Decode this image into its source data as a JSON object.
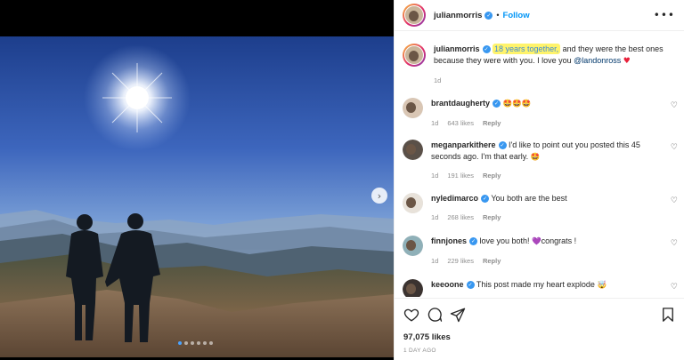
{
  "post": {
    "username": "julianmorris",
    "follow_sep": "•",
    "follow_label": "Follow",
    "more_icon": "more-horizontal-icon",
    "caption": {
      "highlight": "18 years together,",
      "text": " and they were the best ones because they were with you. I love you ",
      "mention": "@landonross",
      "emoji": "heart",
      "age": "1d"
    },
    "carousel": {
      "slide_count": 6,
      "active_index": 0
    }
  },
  "comments": [
    {
      "username": "brantdaugherty",
      "text": "",
      "emoji": "🤩🤩🤩",
      "age": "1d",
      "likes": "643 likes",
      "reply": "Reply"
    },
    {
      "username": "meganparkithere",
      "text": "I'd like to point out you posted this 45 seconds ago. I'm that early. ",
      "emoji": "🤩",
      "age": "1d",
      "likes": "191 likes",
      "reply": "Reply"
    },
    {
      "username": "nyledimarco",
      "text": "You both are the best",
      "emoji": "",
      "age": "1d",
      "likes": "268 likes",
      "reply": "Reply"
    },
    {
      "username": "finnjones",
      "text": " love you both! ",
      "emoji_before": "💜",
      "text2": "congrats !",
      "age": "1d",
      "likes": "229 likes",
      "reply": "Reply"
    },
    {
      "username": "keeoone",
      "text": "This post made my heart explode ",
      "emoji": "🤯"
    }
  ],
  "footer": {
    "likes": "97,075 likes",
    "time": "1 DAY AGO"
  },
  "colors": {
    "link": "#0095f6",
    "verified": "#3897f0",
    "highlight": "#fff36b"
  }
}
